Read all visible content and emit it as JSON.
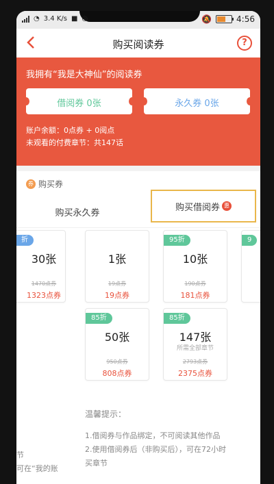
{
  "status_bar": {
    "network_speed": "3.4 K/s",
    "time": "4:56"
  },
  "header": {
    "title": "购买阅读券",
    "help_glyph": "?"
  },
  "hero": {
    "title": "我拥有“我是大神仙”的阅读券",
    "borrow_ticket": "借阅券 0张",
    "permanent_ticket": "永久券 0张",
    "balance": "账户余额：0点券 + 0阅点",
    "unread_chapters": "未观看的付费章节：共147话"
  },
  "section": {
    "buy_label": "购买券",
    "buy_icon_glyph": "券"
  },
  "tabs": [
    {
      "label": "购买永久券"
    },
    {
      "label": "购买借阅券",
      "badge": "惠"
    }
  ],
  "packages": [
    {
      "discount": "折",
      "qty": "30张",
      "orig": "1470点券",
      "price": "1323点券",
      "discount_color": "#6aa6e8"
    },
    {
      "discount": "",
      "qty": "1张",
      "orig": "19点券",
      "price": "19点券"
    },
    {
      "discount": "95折",
      "qty": "10张",
      "orig": "190点券",
      "price": "181点券",
      "discount_color": "#5fc79a"
    },
    {
      "discount": "9",
      "qty": "",
      "orig": "",
      "price": ""
    },
    {
      "discount": "85折",
      "qty": "50张",
      "orig": "950点券",
      "price": "808点券",
      "discount_color": "#5fc79a"
    },
    {
      "discount": "85折",
      "qty": "147张",
      "sub": "所需全部章节",
      "orig": "2793点券",
      "price": "2375点券",
      "discount_color": "#5fc79a"
    }
  ],
  "tips": {
    "title": "温馨提示：",
    "lines": [
      "1.借阅券与作品绑定，不可阅读其他作品",
      "2.使用借阅券后（非购买后），可在72小时",
      "买章节"
    ],
    "left_partial": [
      "节",
      "可在“我的账"
    ]
  },
  "colors": {
    "accent": "#e8583f",
    "green_discount": "#5fc79a",
    "blue_discount": "#6aa6e8",
    "highlight_border": "#e9b64a"
  }
}
